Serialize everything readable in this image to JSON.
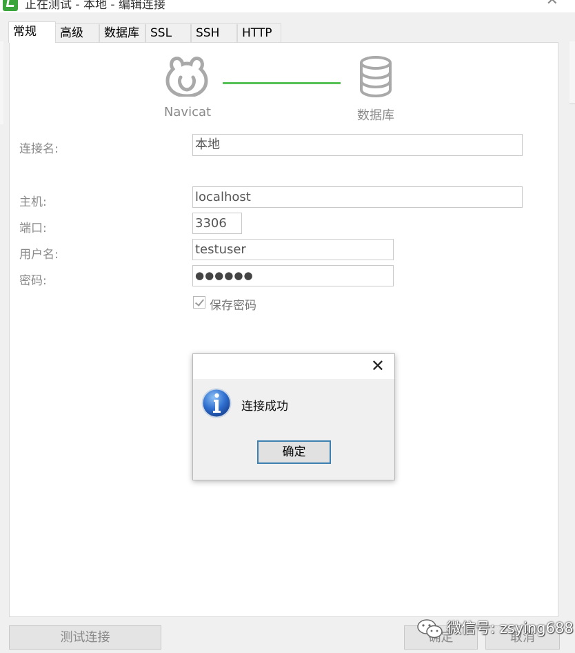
{
  "window": {
    "title": "正在测试 - 本地 - 编辑连接"
  },
  "tabs": [
    "常规",
    "高级",
    "数据库",
    "SSL",
    "SSH",
    "HTTP"
  ],
  "header": {
    "left_caption": "Navicat",
    "right_caption": "数据库",
    "line_color": "#55c155"
  },
  "form": {
    "connection_name": {
      "label": "连接名:",
      "value": "本地"
    },
    "host": {
      "label": "主机:",
      "value": "localhost"
    },
    "port": {
      "label": "端口:",
      "value": "3306"
    },
    "username": {
      "label": "用户名:",
      "value": "testuser"
    },
    "password": {
      "label": "密码:",
      "value": "●●●●●●"
    },
    "save_password": {
      "label": "保存密码",
      "checked": true
    }
  },
  "buttons": {
    "test_connection": "测试连接",
    "ok": "确定",
    "cancel": "取消"
  },
  "dialog": {
    "message": "连接成功",
    "ok": "确定",
    "icon": "info-icon"
  },
  "watermark": {
    "text": "微信号: zsying688"
  }
}
